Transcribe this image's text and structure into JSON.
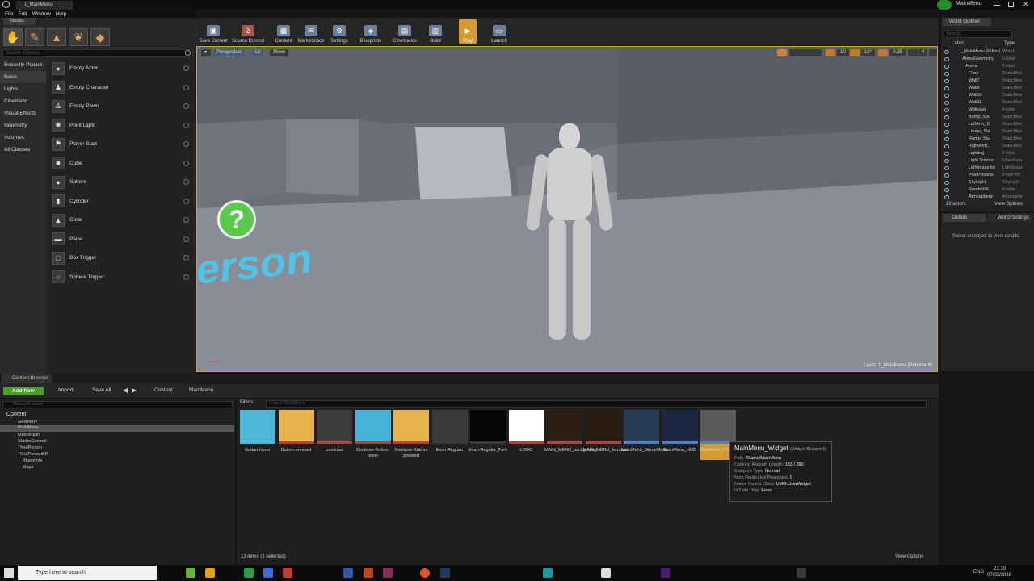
{
  "window": {
    "tab": "1_MainMenu",
    "project": "MainMenu"
  },
  "menu": [
    "File",
    "Edit",
    "Window",
    "Help"
  ],
  "modes": {
    "tab": "Modes",
    "search_placeholder": "Search Classes",
    "categories": [
      "Recently Placed",
      "Basic",
      "Lights",
      "Cinematic",
      "Visual Effects",
      "Geometry",
      "Volumes",
      "All Classes"
    ],
    "items": [
      "Empty Actor",
      "Empty Character",
      "Empty Pawn",
      "Point Light",
      "Player Start",
      "Cube",
      "Sphere",
      "Cylinder",
      "Cone",
      "Plane",
      "Box Trigger",
      "Sphere Trigger"
    ]
  },
  "toolbar": [
    "Save Current",
    "Source Control",
    "Content",
    "Marketplace",
    "Settings",
    "Blueprints",
    "Cinematics",
    "Build",
    "Play",
    "Launch"
  ],
  "viewport": {
    "perspective": "Perspective",
    "lit": "Lit",
    "show": "Show",
    "floor_text": "erson",
    "level": "Level:  1_MainMenu (Persistent)",
    "snap_values": [
      "10",
      "10°",
      "0.25",
      "4"
    ]
  },
  "outliner": {
    "tab": "World Outliner",
    "search_placeholder": "Search...",
    "col_label": "Label",
    "col_type": "Type",
    "rows": [
      [
        "1_MainMenu (Editor)",
        "World"
      ],
      [
        "ArenaGeometry",
        "Folder"
      ],
      [
        "Arena",
        "Folder"
      ],
      [
        "Floor",
        "StaticMes"
      ],
      [
        "Wall7",
        "StaticMes"
      ],
      [
        "Wall9",
        "StaticMes"
      ],
      [
        "Wall10",
        "StaticMes"
      ],
      [
        "Wall11",
        "StaticMes"
      ],
      [
        "Walkway",
        "Folder"
      ],
      [
        "Bump_Sta",
        "StaticMes"
      ],
      [
        "LeftArm_S",
        "StaticMes"
      ],
      [
        "Linear_Sta",
        "StaticMes"
      ],
      [
        "Ramp_Sta",
        "StaticMes"
      ],
      [
        "RightArm_",
        "StaticMes"
      ],
      [
        "Lighting",
        "Folder"
      ],
      [
        "Light Source",
        "Directiona"
      ],
      [
        "Lightmass Im",
        "Lightmass"
      ],
      [
        "PostProcess",
        "PostProc"
      ],
      [
        "SkyLight",
        "SkyLight"
      ],
      [
        "RenderFX",
        "Folder"
      ],
      [
        "Atmospheric",
        "Atmosphe"
      ]
    ],
    "count": "22 actors",
    "view_options": "View Options"
  },
  "details": {
    "tab": "Details",
    "tab2": "World Settings",
    "empty": "Select an object to view details."
  },
  "content_browser": {
    "tab": "Content Browser",
    "add_new": "Add New",
    "import": "Import",
    "save_all": "Save All",
    "breadcrumb": [
      "Content",
      "MainMenu"
    ],
    "folder_search": "Search Folders",
    "filters": "Filters",
    "asset_search": "Search MainMenu",
    "tree": [
      "Content",
      "Geometry",
      "MainMenu",
      "Mannequin",
      "StarterContent",
      "ThirdPerson",
      "ThirdPersonBP",
      "Blueprints",
      "Maps"
    ],
    "assets": [
      {
        "name": "Button-hover",
        "color": "#4fb6d9",
        "bar": "#4fb6d9"
      },
      {
        "name": "Button-pressed",
        "color": "#e9b44c",
        "bar": "#c23b3b"
      },
      {
        "name": "continue",
        "color": "#3d3d3d",
        "bar": "#c23b3b"
      },
      {
        "name": "Continue-Button-hover",
        "color": "#45b3d6",
        "bar": "#c23b3b"
      },
      {
        "name": "Continue-Button-pressed",
        "color": "#e8b24a",
        "bar": "#c23b3b"
      },
      {
        "name": "Exan-Regular",
        "color": "#3a3a3a",
        "bar": "#3a3a3a"
      },
      {
        "name": "Exan-Regular_Font",
        "color": "#050505",
        "bar": "#3a3a3a"
      },
      {
        "name": "LOGO",
        "color": "#ffffff",
        "bar": "#c23b3b"
      },
      {
        "name": "MAIN_MENU_background",
        "color": "#2c1d14",
        "bar": "#c23b3b"
      },
      {
        "name": "MAIN_MENU_template",
        "color": "#2a1c12",
        "bar": "#c23b3b"
      },
      {
        "name": "MainMenu_GameMode",
        "color": "#263a55",
        "bar": "#4f7dd1"
      },
      {
        "name": "MainMenu_HUD",
        "color": "#1b2440",
        "bar": "#4f7dd1"
      },
      {
        "name": "MainMenu_Widget",
        "color": "#5a5a5a",
        "bar": "#4f7dd1"
      }
    ],
    "status": "13 items (1 selected)",
    "view_options": "View Options"
  },
  "tooltip": {
    "title": "MainMenu_Widget",
    "kind": "(Widget Blueprint)",
    "lines": [
      [
        "Path:",
        "/Game/MainMenu"
      ],
      [
        "Cooking Filepath Length:",
        "183 / 260"
      ],
      [
        "Blueprint Type:",
        "Normal"
      ],
      [
        "Num Replicated Properties:",
        "0"
      ],
      [
        "Native Parent Class:",
        "UMG.UserWidget"
      ],
      [
        "Is Data Only:",
        "False"
      ]
    ]
  },
  "taskbar": {
    "search": "Type here to search",
    "lang": "ENG",
    "time": "21:10",
    "date": "07/03/2018"
  }
}
